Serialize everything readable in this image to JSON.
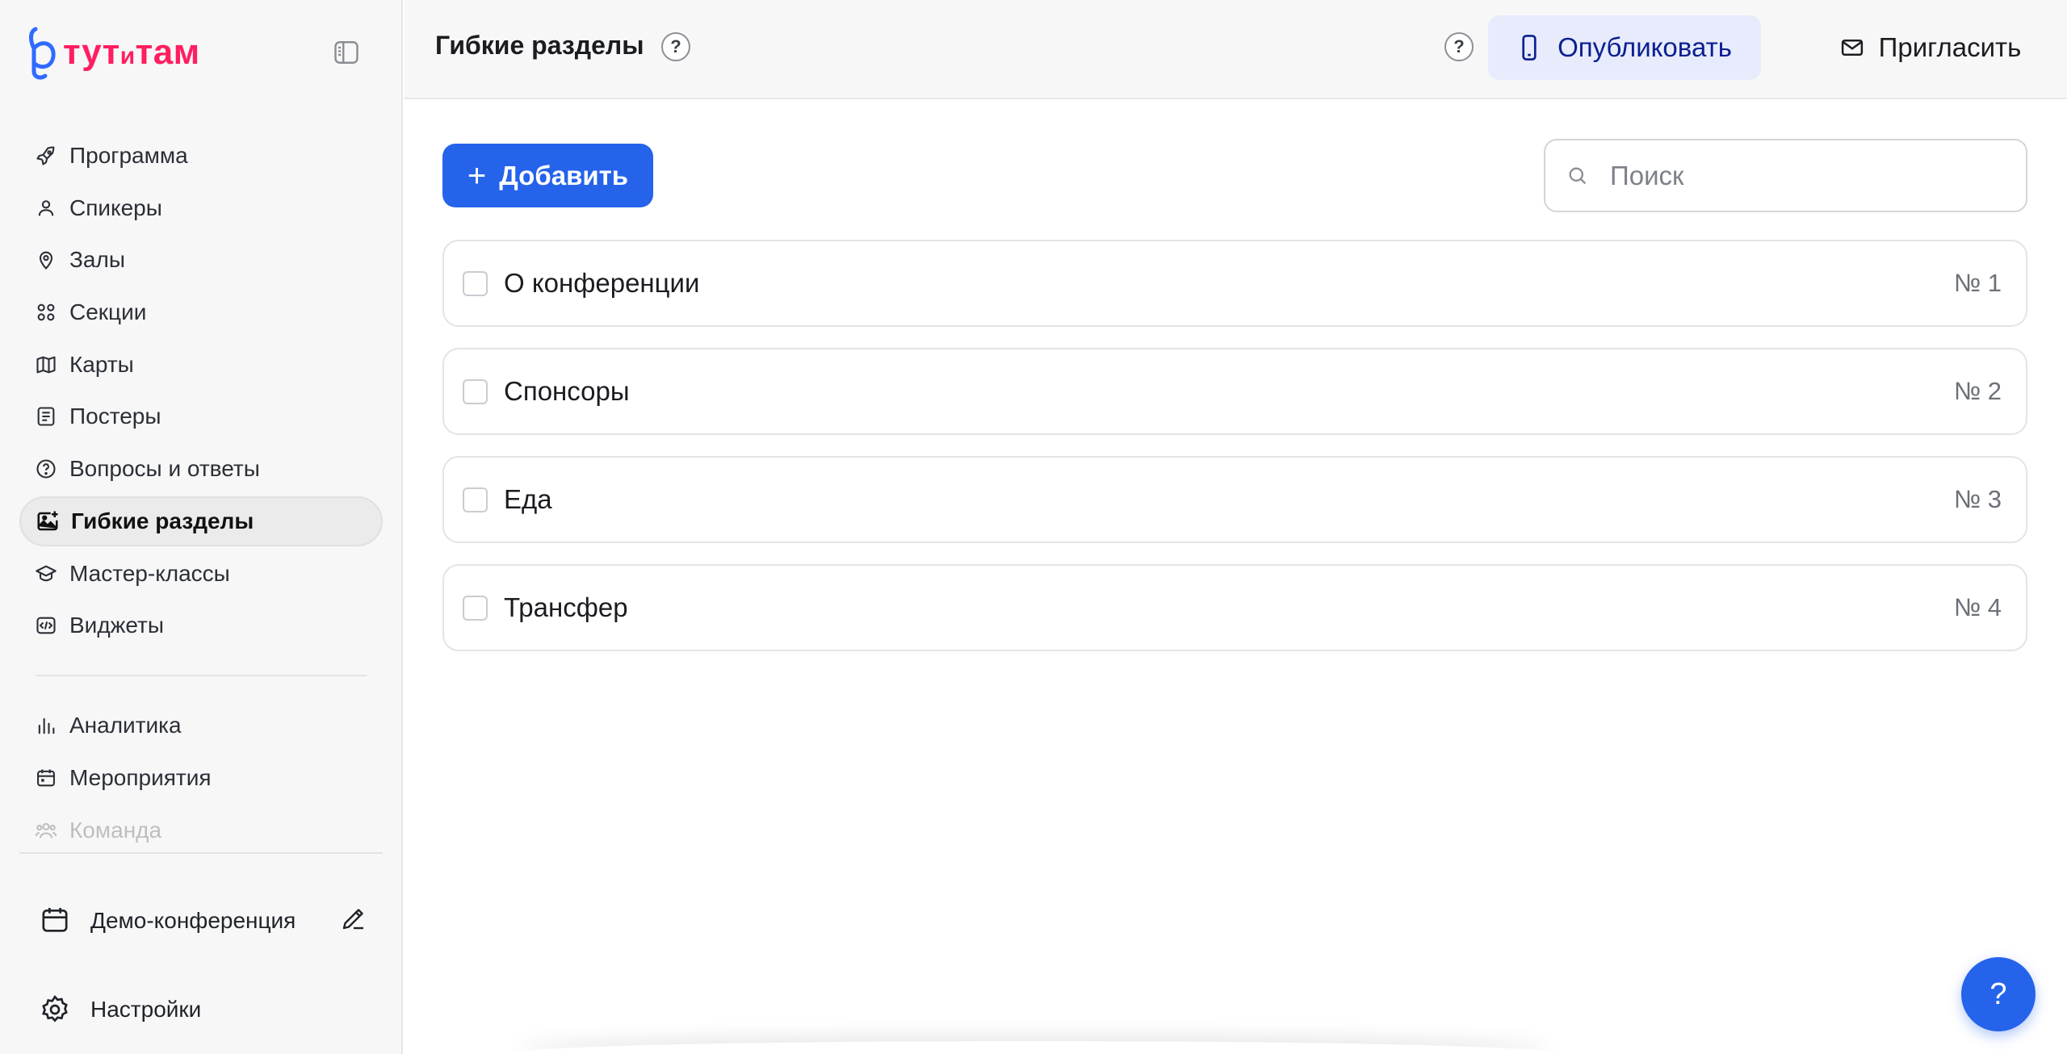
{
  "brand": {
    "logo_text_big1": "тут",
    "logo_text_small": "и",
    "logo_text_big2": "там",
    "logo_color": "#ff1e60",
    "mark_color": "#2f6bff"
  },
  "sidebar": {
    "items": [
      {
        "label": "Программа",
        "icon": "rocket-icon"
      },
      {
        "label": "Спикеры",
        "icon": "user-icon"
      },
      {
        "label": "Залы",
        "icon": "map-pin-icon"
      },
      {
        "label": "Секции",
        "icon": "grid-circles-icon"
      },
      {
        "label": "Карты",
        "icon": "map-icon"
      },
      {
        "label": "Постеры",
        "icon": "poster-icon"
      },
      {
        "label": "Вопросы и ответы",
        "icon": "question-circle-icon"
      },
      {
        "label": "Гибкие разделы",
        "icon": "image-sparkle-icon",
        "active": true
      },
      {
        "label": "Мастер-классы",
        "icon": "graduation-cap-icon"
      },
      {
        "label": "Виджеты",
        "icon": "code-icon"
      }
    ],
    "items2": [
      {
        "label": "Аналитика",
        "icon": "bar-chart-icon"
      },
      {
        "label": "Мероприятия",
        "icon": "calendar-icon"
      },
      {
        "label": "Команда",
        "icon": "team-icon"
      }
    ],
    "event_name": "Демо-конференция",
    "settings_label": "Настройки"
  },
  "header": {
    "title": "Гибкие разделы",
    "help_glyph": "?",
    "publish_label": "Опубликовать",
    "invite_label": "Пригласить"
  },
  "toolbar": {
    "add_label": "Добавить",
    "add_glyph": "+",
    "search_placeholder": "Поиск"
  },
  "sections": [
    {
      "name": "О конференции",
      "number": "№ 1"
    },
    {
      "name": "Спонсоры",
      "number": "№ 2"
    },
    {
      "name": "Еда",
      "number": "№ 3"
    },
    {
      "name": "Трансфер",
      "number": "№ 4"
    }
  ],
  "fab": {
    "glyph": "?"
  },
  "colors": {
    "primary": "#2563eb",
    "publish_bg": "#e7ebfc",
    "publish_text": "#0b1f8f",
    "sidebar_bg": "#f7f7f8"
  }
}
